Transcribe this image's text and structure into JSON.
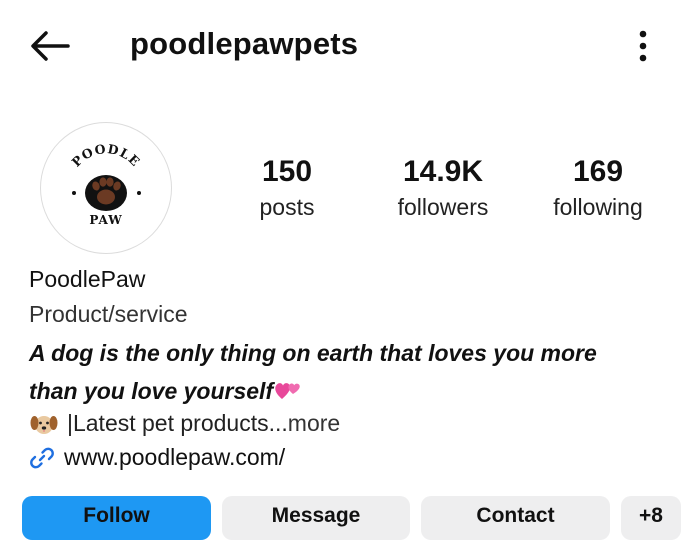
{
  "header": {
    "username": "poodlepawpets"
  },
  "profile": {
    "logo_text_top": "POODLE",
    "logo_text_bottom": "PAW",
    "stats": [
      {
        "value": "150",
        "label": "posts"
      },
      {
        "value": "14.9K",
        "label": "followers"
      },
      {
        "value": "169",
        "label": "following"
      }
    ],
    "name": "PoodlePaw",
    "category": "Product/service",
    "bio_line1": "A dog is the only thing on earth that loves you more",
    "bio_line2": "than you love yourself",
    "bio_more_text": " |Latest pet products... ",
    "more_label": "more",
    "website": "www.poodlepaw.com/"
  },
  "actions": {
    "follow": "Follow",
    "message": "Message",
    "contact": "Contact",
    "more": "+8"
  },
  "colors": {
    "follow_button": "#1e98f3",
    "secondary_button": "#eeeeef",
    "logo_brown": "#6b3a23"
  },
  "icons": [
    "back-arrow-icon",
    "more-options-icon",
    "dog-emoji-icon",
    "heart-emoji-icon",
    "link-icon",
    "paw-icon"
  ]
}
